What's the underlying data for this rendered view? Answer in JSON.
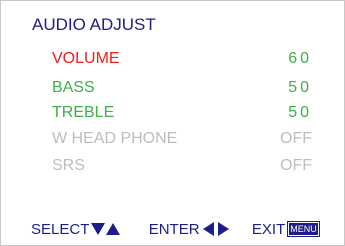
{
  "title": "AUDIO ADJUST",
  "items": [
    {
      "label": "VOLUME",
      "value": "60"
    },
    {
      "label": "BASS",
      "value": "50"
    },
    {
      "label": "TREBLE",
      "value": "50"
    },
    {
      "label": "W HEAD PHONE",
      "value": "OFF"
    },
    {
      "label": "SRS",
      "value": "OFF"
    }
  ],
  "footer": {
    "select_label": "SELECT",
    "enter_label": "ENTER",
    "exit_label": "EXIT",
    "menu_key_label": "MENU",
    "select_icons": [
      "triangle-down-icon",
      "triangle-up-icon"
    ],
    "enter_icons": [
      "triangle-left-icon",
      "triangle-right-icon"
    ]
  },
  "colors": {
    "text_primary": "#1c1c8c",
    "selected": "#ee1c1c",
    "value_active": "#3fae49",
    "disabled": "#bdbdbd"
  }
}
